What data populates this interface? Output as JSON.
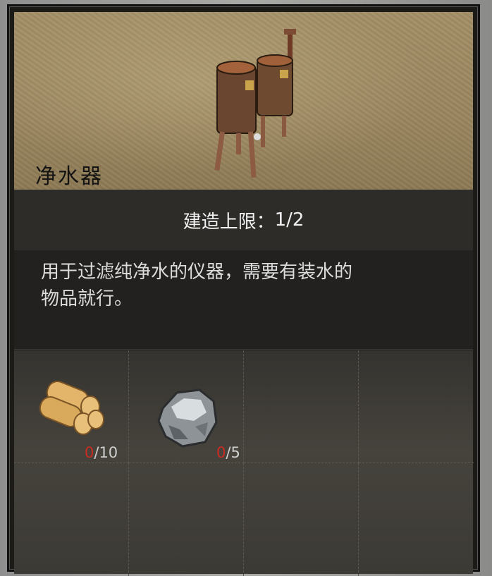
{
  "item": {
    "name": "净水器",
    "image_icon": "water-purifier-icon"
  },
  "build_limit": {
    "label": "建造上限：",
    "current": 1,
    "max": 2,
    "text": "1/2"
  },
  "description": {
    "line1": "用于过滤纯净水的仪器，需要有装水的",
    "line2": "物品就行。"
  },
  "materials": [
    {
      "icon": "wood-logs-icon",
      "have": "0",
      "need": "/10"
    },
    {
      "icon": "stone-icon",
      "have": "0",
      "need": "/5"
    }
  ],
  "colors": {
    "missing": "#cc2b22",
    "header_bg": "#a49067"
  }
}
